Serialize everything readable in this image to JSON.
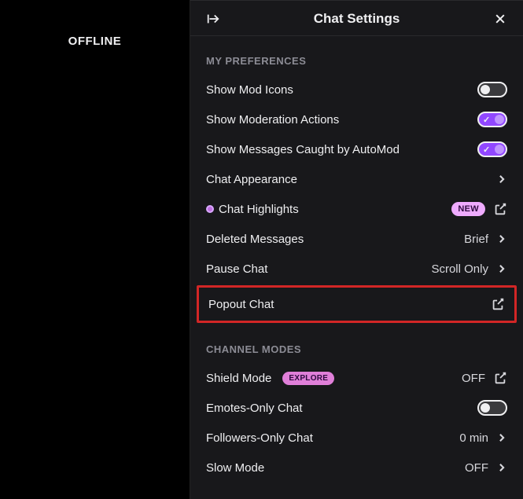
{
  "sidebar": {
    "status": "OFFLINE"
  },
  "panel": {
    "title": "Chat Settings",
    "sections": {
      "prefs": {
        "heading": "MY PREFERENCES",
        "showModIcons": "Show Mod Icons",
        "showModActions": "Show Moderation Actions",
        "showAutomod": "Show Messages Caught by AutoMod",
        "chatAppearance": "Chat Appearance",
        "chatHighlights": "Chat Highlights",
        "chatHighlightsBadge": "NEW",
        "deletedMessages": "Deleted Messages",
        "deletedMessagesValue": "Brief",
        "pauseChat": "Pause Chat",
        "pauseChatValue": "Scroll Only",
        "popoutChat": "Popout Chat"
      },
      "modes": {
        "heading": "CHANNEL MODES",
        "shieldMode": "Shield Mode",
        "shieldModeBadge": "EXPLORE",
        "shieldModeValue": "OFF",
        "emotesOnly": "Emotes-Only Chat",
        "followersOnly": "Followers-Only Chat",
        "followersOnlyValue": "0 min",
        "slowMode": "Slow Mode",
        "slowModeValue": "OFF"
      }
    }
  }
}
